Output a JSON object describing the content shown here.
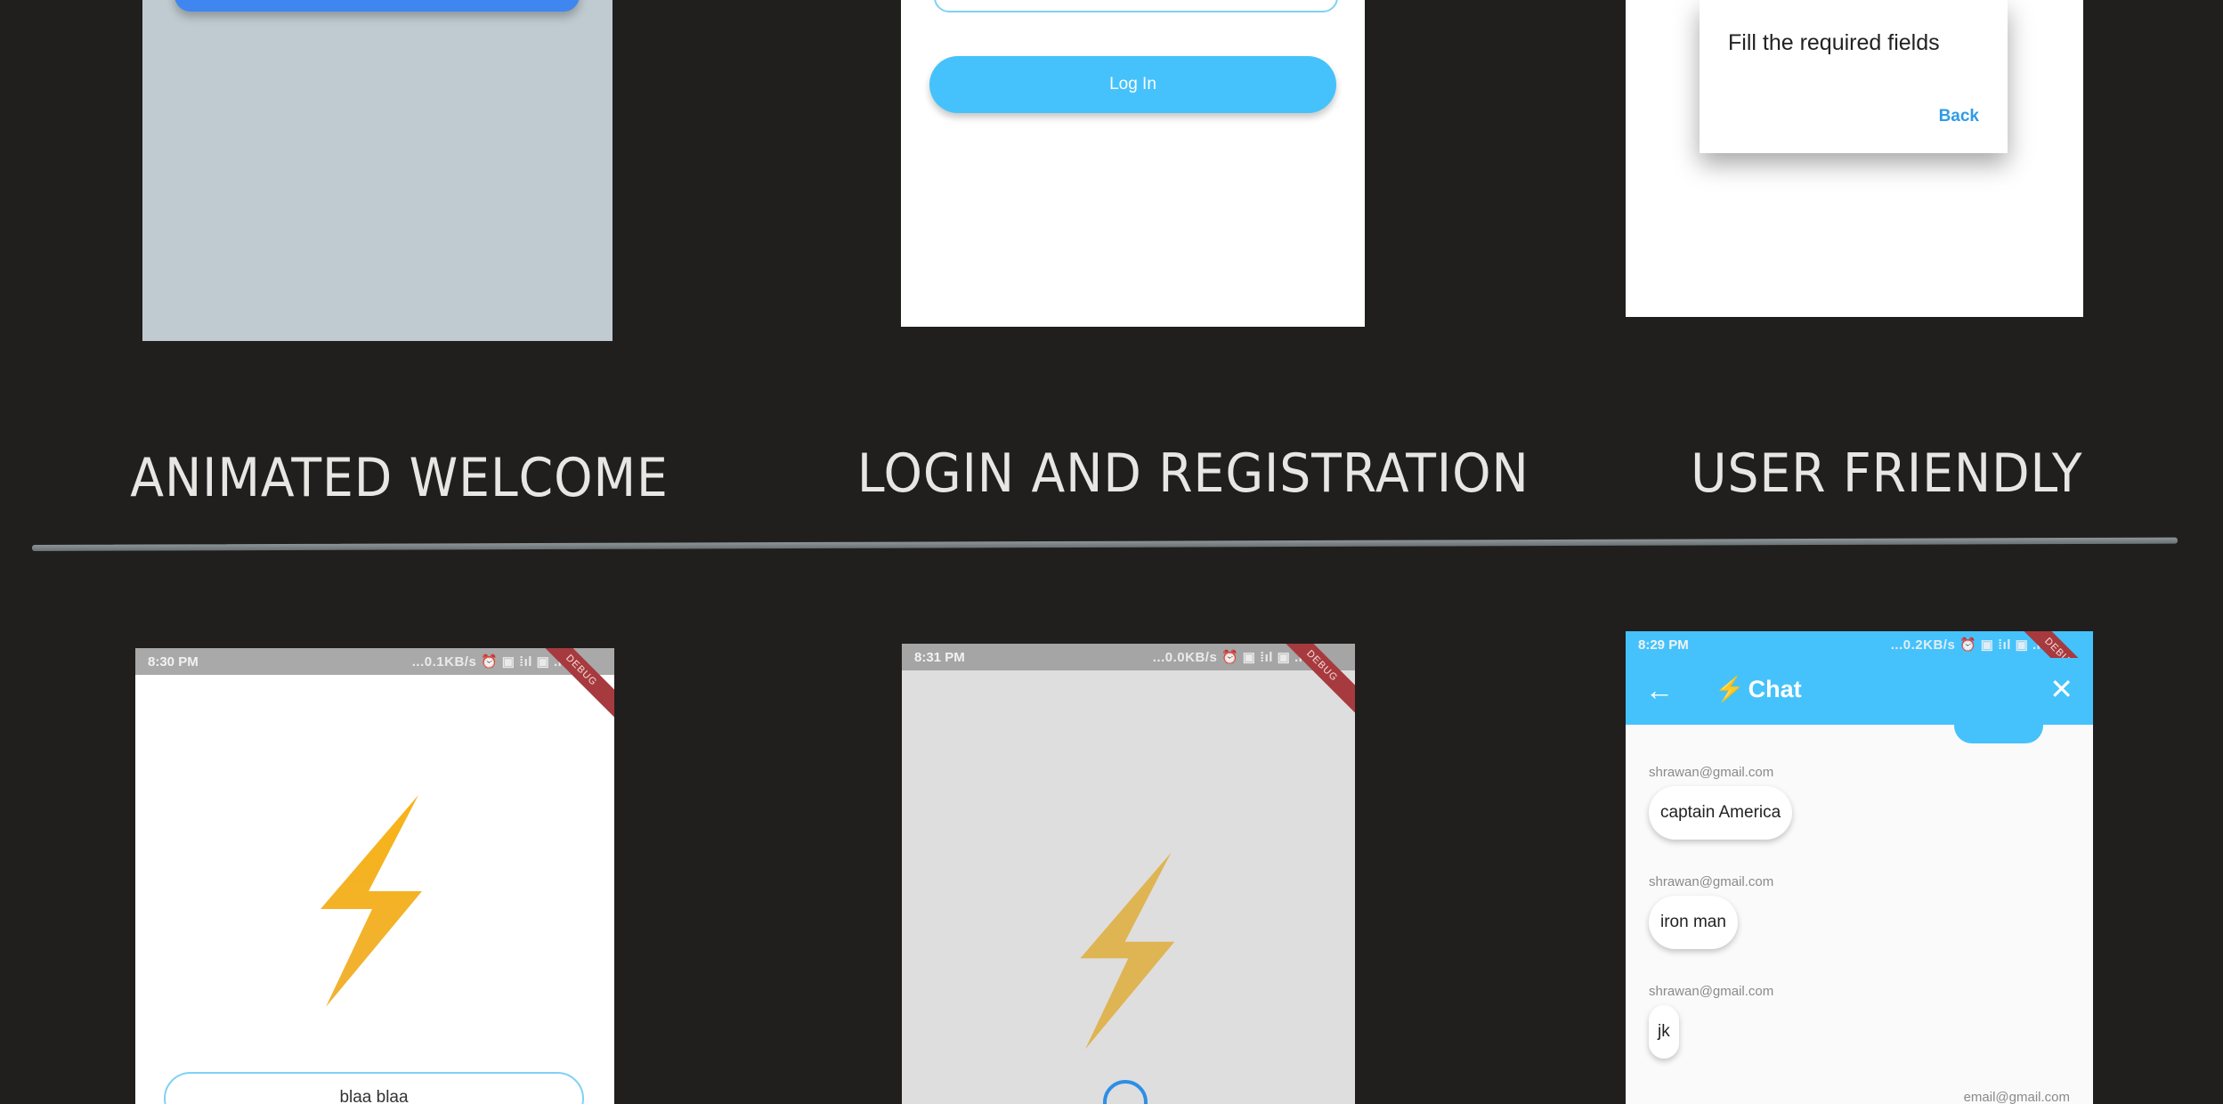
{
  "top_shots": {
    "login": {
      "button_label": "Log In"
    },
    "dialog": {
      "message": "Fill the required fields",
      "action_label": "Back"
    }
  },
  "captions": {
    "col1": "ANIMATED WELCOME",
    "col2": "LOGIN AND REGISTRATION",
    "col3": "USER FRIENDLY"
  },
  "bottom_shots": {
    "welcome": {
      "status_time": "8:30 PM",
      "status_icons": "...0.1KB/s ⏰ ▣ ⁞ıl ▣ .ıl",
      "ribbon": "DEBUG",
      "field_value": "blaa blaa"
    },
    "loading": {
      "status_time": "8:31 PM",
      "status_icons": "...0.0KB/s ⏰ ▣ ⁞ıl ▣ .ıl",
      "ribbon": "DEBUG"
    },
    "chat": {
      "status_time": "8:29 PM",
      "status_icons": "...0.2KB/s ⏰ ▣ ⁞ıl ▣ .ıl",
      "ribbon": "DEBUG",
      "title_icon": "⚡",
      "title": "Chat",
      "messages": [
        {
          "sender": "shrawan@gmail.com",
          "text": "captain America"
        },
        {
          "sender": "shrawan@gmail.com",
          "text": "iron man"
        },
        {
          "sender": "shrawan@gmail.com",
          "text": "jk"
        }
      ],
      "partial_sender": "email@gmail.com"
    }
  },
  "icons": {
    "bolt": "lightning-bolt-icon",
    "back": "arrow-left-icon",
    "close": "close-icon"
  },
  "colors": {
    "background": "#201f1e",
    "accent": "#45c2fb",
    "bolt_gold": "#f6b81e",
    "debug_ribbon": "#a73a3e"
  }
}
